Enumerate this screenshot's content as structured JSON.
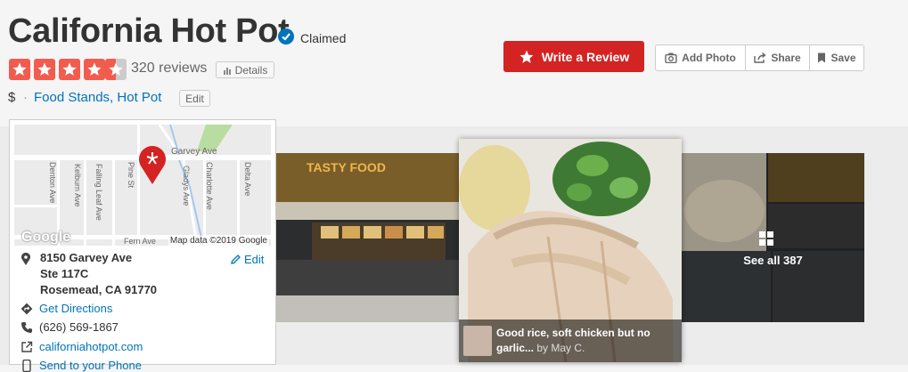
{
  "business": {
    "name": "California Hot Pot",
    "claimed_label": "Claimed",
    "rating_stars": 4.5,
    "review_count_text": "320 reviews",
    "details_label": "Details",
    "price": "$",
    "categories": "Food Stands, Hot Pot",
    "edit_label": "Edit"
  },
  "actions": {
    "write_review": "Write a Review",
    "add_photo": "Add Photo",
    "share": "Share",
    "save": "Save"
  },
  "map": {
    "streets": {
      "garvey": "Garvey Ave",
      "fern": "Fern Ave",
      "denton": "Denton Ave",
      "kelburn": "Kelburn Ave",
      "falling_leaf": "Falling Leaf Ave",
      "pine": "Pine St",
      "gladys": "Gladys Ave",
      "charlotte": "Charlotte Ave",
      "delta": "Delta Ave"
    },
    "logo": "Google",
    "attribution": "Map data ©2019 Google"
  },
  "info": {
    "address_line1": "8150 Garvey Ave",
    "address_line2": "Ste 117C",
    "address_line3": "Rosemead, CA 91770",
    "address_edit": "Edit",
    "directions": "Get Directions",
    "phone": "(626) 569-1867",
    "website": "californiahotpot.com",
    "send_to_phone": "Send to your Phone"
  },
  "photos": {
    "caption": "Good rice, soft chicken but no garlic...",
    "caption_by": "by May C.",
    "see_all": "See all 387",
    "sign_text": "TASTY FOOD"
  },
  "colors": {
    "brand_red": "#d32323",
    "link_blue": "#0073bb",
    "star_red": "#f15c4f"
  }
}
